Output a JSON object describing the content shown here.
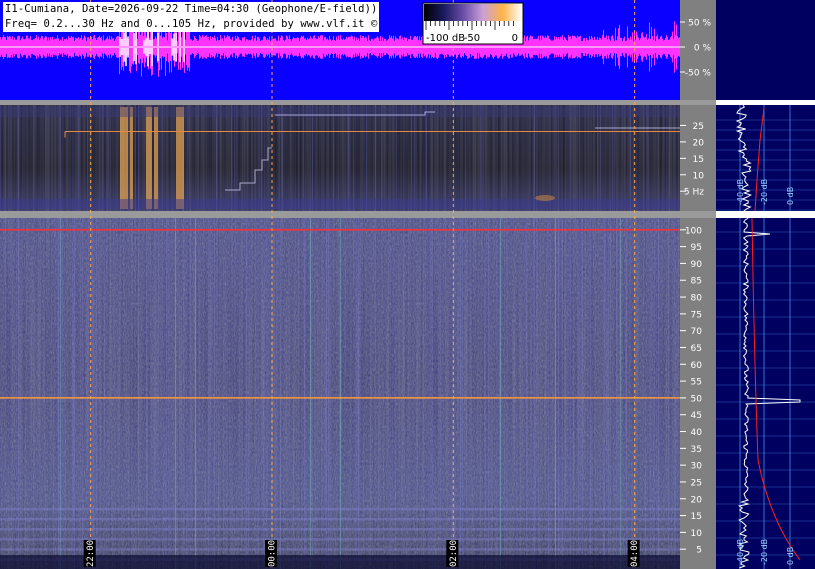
{
  "header": {
    "line1": "I1-Cumiana, Date=2026-09-22 Time=04:30 (Geophone/E-field))",
    "line2": "Freq= 0.2...30 Hz and 0...105 Hz, provided by www.vlf.it ©"
  },
  "colorbar": {
    "ticks": [
      "-100 dB",
      "-50",
      "0"
    ],
    "colors": [
      "#000000",
      "#1a1a5e",
      "#6a4ea8",
      "#c9a0d8",
      "#ffb347",
      "#ffffff"
    ]
  },
  "chart_data": [
    {
      "type": "line",
      "name": "waveform-panel",
      "ylim": [
        -100,
        100
      ],
      "yticks": [
        {
          "value": 50,
          "label": "50 %"
        },
        {
          "value": 0,
          "label": "0 %"
        },
        {
          "value": -50,
          "label": "-50 %"
        }
      ],
      "colors": {
        "background": "#0a00ff",
        "trace": "#ff33ff"
      }
    },
    {
      "type": "heatmap",
      "name": "spectrogram-low",
      "ylim": [
        0.2,
        30
      ],
      "yticks": [
        {
          "value": 25,
          "label": "25"
        },
        {
          "value": 20,
          "label": "20"
        },
        {
          "value": 15,
          "label": "15"
        },
        {
          "value": 10,
          "label": "10"
        },
        {
          "value": 5,
          "label": "5 Hz"
        }
      ],
      "markers": [
        {
          "freq": 25,
          "color": "#e88a3a"
        }
      ]
    },
    {
      "type": "heatmap",
      "name": "spectrogram-high",
      "ylim": [
        0,
        105
      ],
      "yticks": [
        {
          "value": 100,
          "label": "100"
        },
        {
          "value": 95,
          "label": "95"
        },
        {
          "value": 90,
          "label": "90"
        },
        {
          "value": 85,
          "label": "85"
        },
        {
          "value": 80,
          "label": "80"
        },
        {
          "value": 75,
          "label": "75"
        },
        {
          "value": 70,
          "label": "70"
        },
        {
          "value": 65,
          "label": "65"
        },
        {
          "value": 60,
          "label": "60"
        },
        {
          "value": 55,
          "label": "55"
        },
        {
          "value": 50,
          "label": "50"
        },
        {
          "value": 45,
          "label": "45"
        },
        {
          "value": 40,
          "label": "40"
        },
        {
          "value": 35,
          "label": "35"
        },
        {
          "value": 30,
          "label": "30"
        },
        {
          "value": 25,
          "label": "25"
        },
        {
          "value": 20,
          "label": "20"
        },
        {
          "value": 15,
          "label": "15"
        },
        {
          "value": 10,
          "label": "10"
        },
        {
          "value": 5,
          "label": "5"
        }
      ],
      "markers": [
        {
          "freq": 100,
          "color": "#ff3030"
        },
        {
          "freq": 50,
          "color": "#ff9a3a"
        }
      ]
    }
  ],
  "time_axis": {
    "range_hours": [
      21.0,
      4.5
    ],
    "marks": [
      {
        "hour": 22,
        "label": "22:00"
      },
      {
        "hour": 24,
        "label": "00:00"
      },
      {
        "hour": 26,
        "label": "02:00"
      },
      {
        "hour": 28,
        "label": "04:00"
      }
    ],
    "marker_color": "#ffaa44"
  },
  "spectrum": {
    "db_labels": [
      "-40 dB",
      "-20 dB",
      "0 dB"
    ],
    "low_curve_color": "#ff2020",
    "trace_color": "#ffffff",
    "background": "#000060"
  }
}
